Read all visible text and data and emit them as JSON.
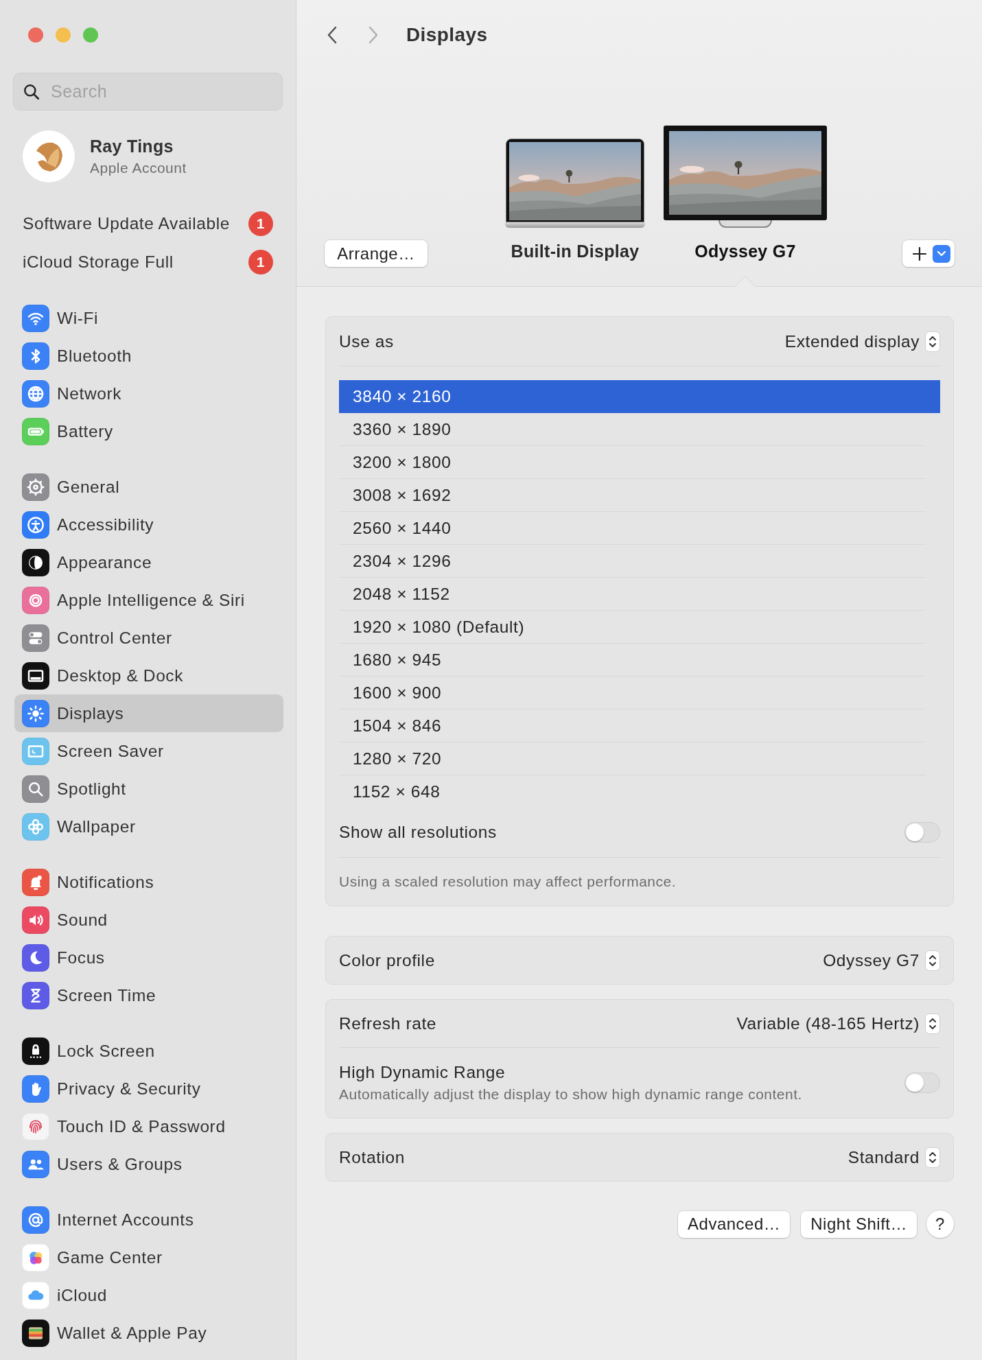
{
  "window": {
    "title": "Displays"
  },
  "navigation": {
    "back": {
      "disabled": false
    },
    "forward": {
      "disabled": true
    }
  },
  "sidebar": {
    "search": {
      "placeholder": "Search"
    },
    "account": {
      "name": "Ray Tings",
      "subtitle": "Apple Account"
    },
    "alerts": [
      {
        "label": "Software Update Available",
        "badge": "1"
      },
      {
        "label": "iCloud Storage Full",
        "badge": "1"
      }
    ],
    "groups": [
      {
        "items": [
          {
            "label": "Wi-Fi",
            "color": "#3b82f6",
            "selected": false
          },
          {
            "label": "Bluetooth",
            "color": "#3b82f6",
            "selected": false
          },
          {
            "label": "Network",
            "color": "#3b82f6",
            "selected": false
          },
          {
            "label": "Battery",
            "color": "#5ccf5a",
            "selected": false
          }
        ]
      },
      {
        "items": [
          {
            "label": "General",
            "color": "#8e8e93",
            "selected": false
          },
          {
            "label": "Accessibility",
            "color": "#2f7cf6",
            "selected": false
          },
          {
            "label": "Appearance",
            "color": "#111111",
            "selected": false
          },
          {
            "label": "Apple Intelligence & Siri",
            "color": "#e9709a",
            "selected": false
          },
          {
            "label": "Control Center",
            "color": "#8e8e93",
            "selected": false
          },
          {
            "label": "Desktop & Dock",
            "color": "#111111",
            "selected": false
          },
          {
            "label": "Displays",
            "color": "#3b82f6",
            "selected": true
          },
          {
            "label": "Screen Saver",
            "color": "#6cc4ee",
            "selected": false
          },
          {
            "label": "Spotlight",
            "color": "#8e8e93",
            "selected": false
          },
          {
            "label": "Wallpaper",
            "color": "#6cc4ee",
            "selected": false
          }
        ]
      },
      {
        "items": [
          {
            "label": "Notifications",
            "color": "#eb5545",
            "selected": false
          },
          {
            "label": "Sound",
            "color": "#eb4a63",
            "selected": false
          },
          {
            "label": "Focus",
            "color": "#5e5ce6",
            "selected": false
          },
          {
            "label": "Screen Time",
            "color": "#5e5ce6",
            "selected": false
          }
        ]
      },
      {
        "items": [
          {
            "label": "Lock Screen",
            "color": "#111111",
            "selected": false
          },
          {
            "label": "Privacy & Security",
            "color": "#3b82f6",
            "selected": false
          },
          {
            "label": "Touch ID & Password",
            "color": "#f5f5f5",
            "selected": false
          },
          {
            "label": "Users & Groups",
            "color": "#3b82f6",
            "selected": false
          }
        ]
      },
      {
        "items": [
          {
            "label": "Internet Accounts",
            "color": "#3b82f6",
            "selected": false
          },
          {
            "label": "Game Center",
            "color": "#ffffff",
            "selected": false
          },
          {
            "label": "iCloud",
            "color": "#ffffff",
            "selected": false
          },
          {
            "label": "Wallet & Apple Pay",
            "color": "#111111",
            "selected": false
          }
        ]
      }
    ]
  },
  "arrange_button": "Arrange…",
  "displays": [
    {
      "name": "Built-in Display",
      "kind": "laptop",
      "selected": false
    },
    {
      "name": "Odyssey G7",
      "kind": "monitor",
      "selected": true
    }
  ],
  "use_as": {
    "label": "Use as",
    "value": "Extended display"
  },
  "resolutions": [
    {
      "label": "3840 × 2160",
      "selected": true
    },
    {
      "label": "3360 × 1890",
      "selected": false
    },
    {
      "label": "3200 × 1800",
      "selected": false
    },
    {
      "label": "3008 × 1692",
      "selected": false
    },
    {
      "label": "2560 × 1440",
      "selected": false
    },
    {
      "label": "2304 × 1296",
      "selected": false
    },
    {
      "label": "2048 × 1152",
      "selected": false
    },
    {
      "label": "1920 × 1080 (Default)",
      "selected": false
    },
    {
      "label": "1680 × 945",
      "selected": false
    },
    {
      "label": "1600 × 900",
      "selected": false
    },
    {
      "label": "1504 × 846",
      "selected": false
    },
    {
      "label": "1280 × 720",
      "selected": false
    },
    {
      "label": "1152 × 648",
      "selected": false
    }
  ],
  "show_all": {
    "label": "Show all resolutions",
    "on": false
  },
  "note": "Using a scaled resolution may affect performance.",
  "settings": [
    {
      "rows": [
        {
          "kind": "select",
          "label": "Color profile",
          "value": "Odyssey G7"
        }
      ]
    },
    {
      "rows": [
        {
          "kind": "select",
          "label": "Refresh rate",
          "value": "Variable (48-165 Hertz)"
        },
        {
          "kind": "toggle",
          "label": "High Dynamic Range",
          "description": "Automatically adjust the display to show high dynamic range content.",
          "on": false
        }
      ]
    },
    {
      "rows": [
        {
          "kind": "select",
          "label": "Rotation",
          "value": "Standard"
        }
      ]
    }
  ],
  "buttons": [
    "Advanced…",
    "Night Shift…"
  ],
  "help_button": "?"
}
